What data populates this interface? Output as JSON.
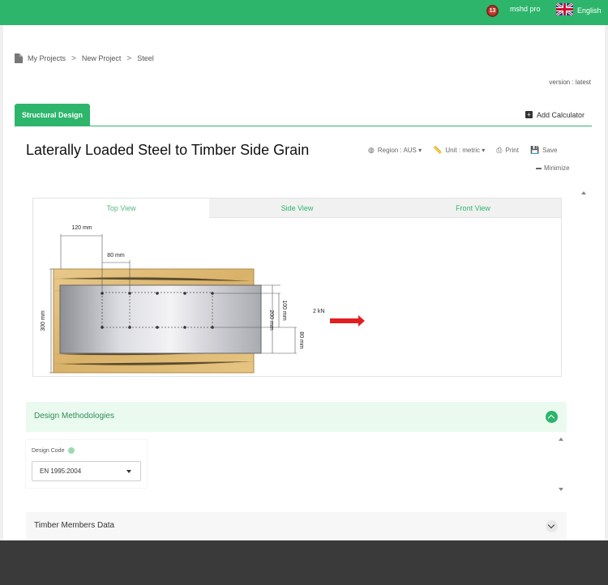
{
  "topbar": {
    "notification_count": "13",
    "user_name": "mshd pro",
    "language": "English",
    "accent_color": "#2db56c"
  },
  "breadcrumb": {
    "items": [
      "My Projects",
      "New Project",
      "Steel"
    ],
    "separator": ">"
  },
  "version": "version : latest",
  "tabs": {
    "active": "Structural Design",
    "add_calculator": "Add Calculator"
  },
  "calculator": {
    "title": "Laterally Loaded Steel to Timber Side Grain",
    "tools": {
      "region": "Region : AUS",
      "unit": "Unit : metric",
      "print": "Print",
      "save": "Save",
      "minimize": "Minimize"
    }
  },
  "viewer": {
    "tabs": [
      "Top View",
      "Side View",
      "Front View"
    ],
    "active_tab": "Top View",
    "dimensions": {
      "top_spacing": "120 mm",
      "inner_spacing": "80 mm",
      "left_height": "300 mm",
      "plate_height": "200 mm",
      "bolt_row_spacing": "100 mm",
      "edge_distance": "80 mm",
      "load": "2 kN"
    }
  },
  "design_methodologies": {
    "title": "Design Methodologies",
    "design_code_label": "Design Code",
    "design_code_value": "EN 1995:2004"
  },
  "timber_members": {
    "title": "Timber Members Data"
  }
}
